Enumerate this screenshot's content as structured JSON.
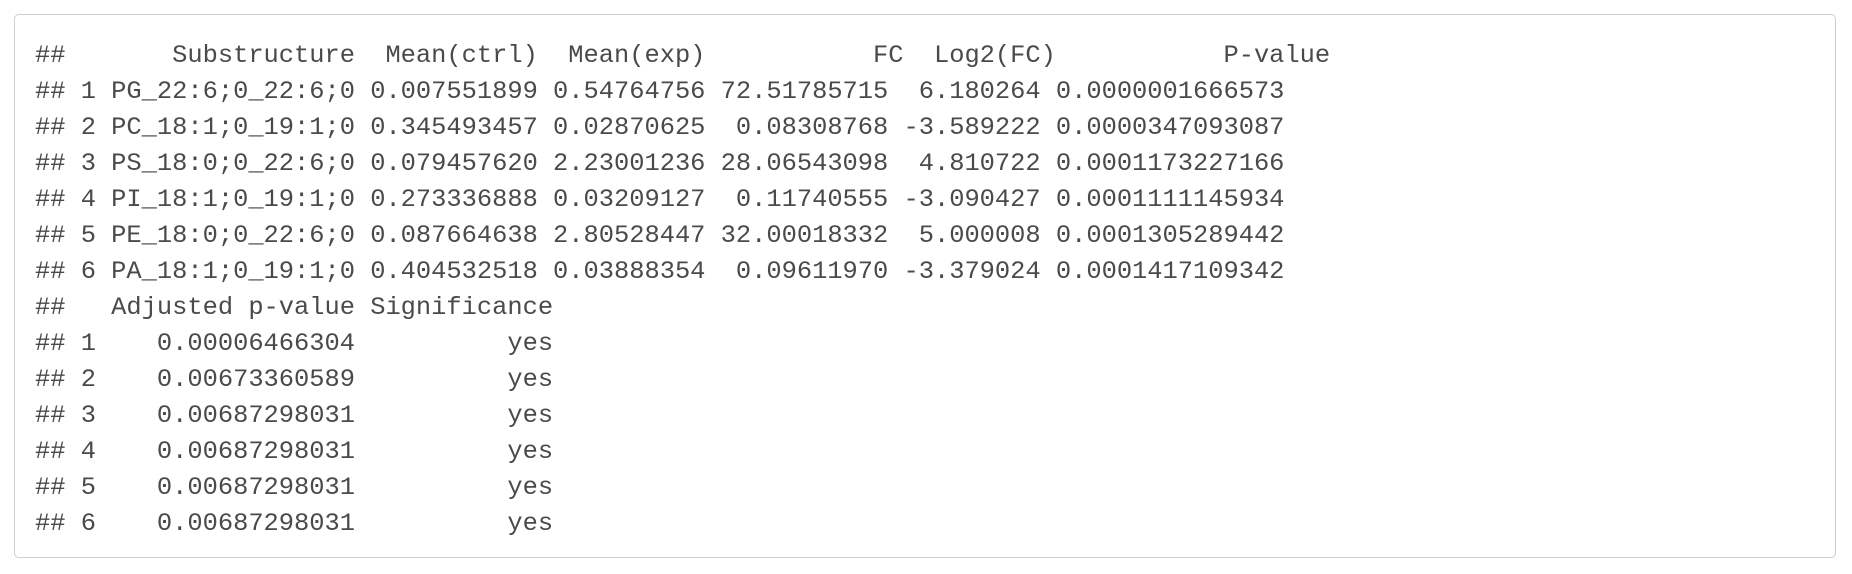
{
  "output": {
    "lines": [
      "##       Substructure  Mean(ctrl)  Mean(exp)           FC  Log2(FC)           P-value",
      "## 1 PG_22:6;0_22:6;0 0.007551899 0.54764756 72.51785715  6.180264 0.0000001666573",
      "## 2 PC_18:1;0_19:1;0 0.345493457 0.02870625  0.08308768 -3.589222 0.0000347093087",
      "## 3 PS_18:0;0_22:6;0 0.079457620 2.23001236 28.06543098  4.810722 0.0001173227166",
      "## 4 PI_18:1;0_19:1;0 0.273336888 0.03209127  0.11740555 -3.090427 0.0001111145934",
      "## 5 PE_18:0;0_22:6;0 0.087664638 2.80528447 32.00018332  5.000008 0.0001305289442",
      "## 6 PA_18:1;0_19:1;0 0.404532518 0.03888354  0.09611970 -3.379024 0.0001417109342",
      "##   Adjusted p-value Significance",
      "## 1    0.00006466304          yes",
      "## 2    0.00673360589          yes",
      "## 3    0.00687298031          yes",
      "## 4    0.00687298031          yes",
      "## 5    0.00687298031          yes",
      "## 6    0.00687298031          yes"
    ]
  }
}
